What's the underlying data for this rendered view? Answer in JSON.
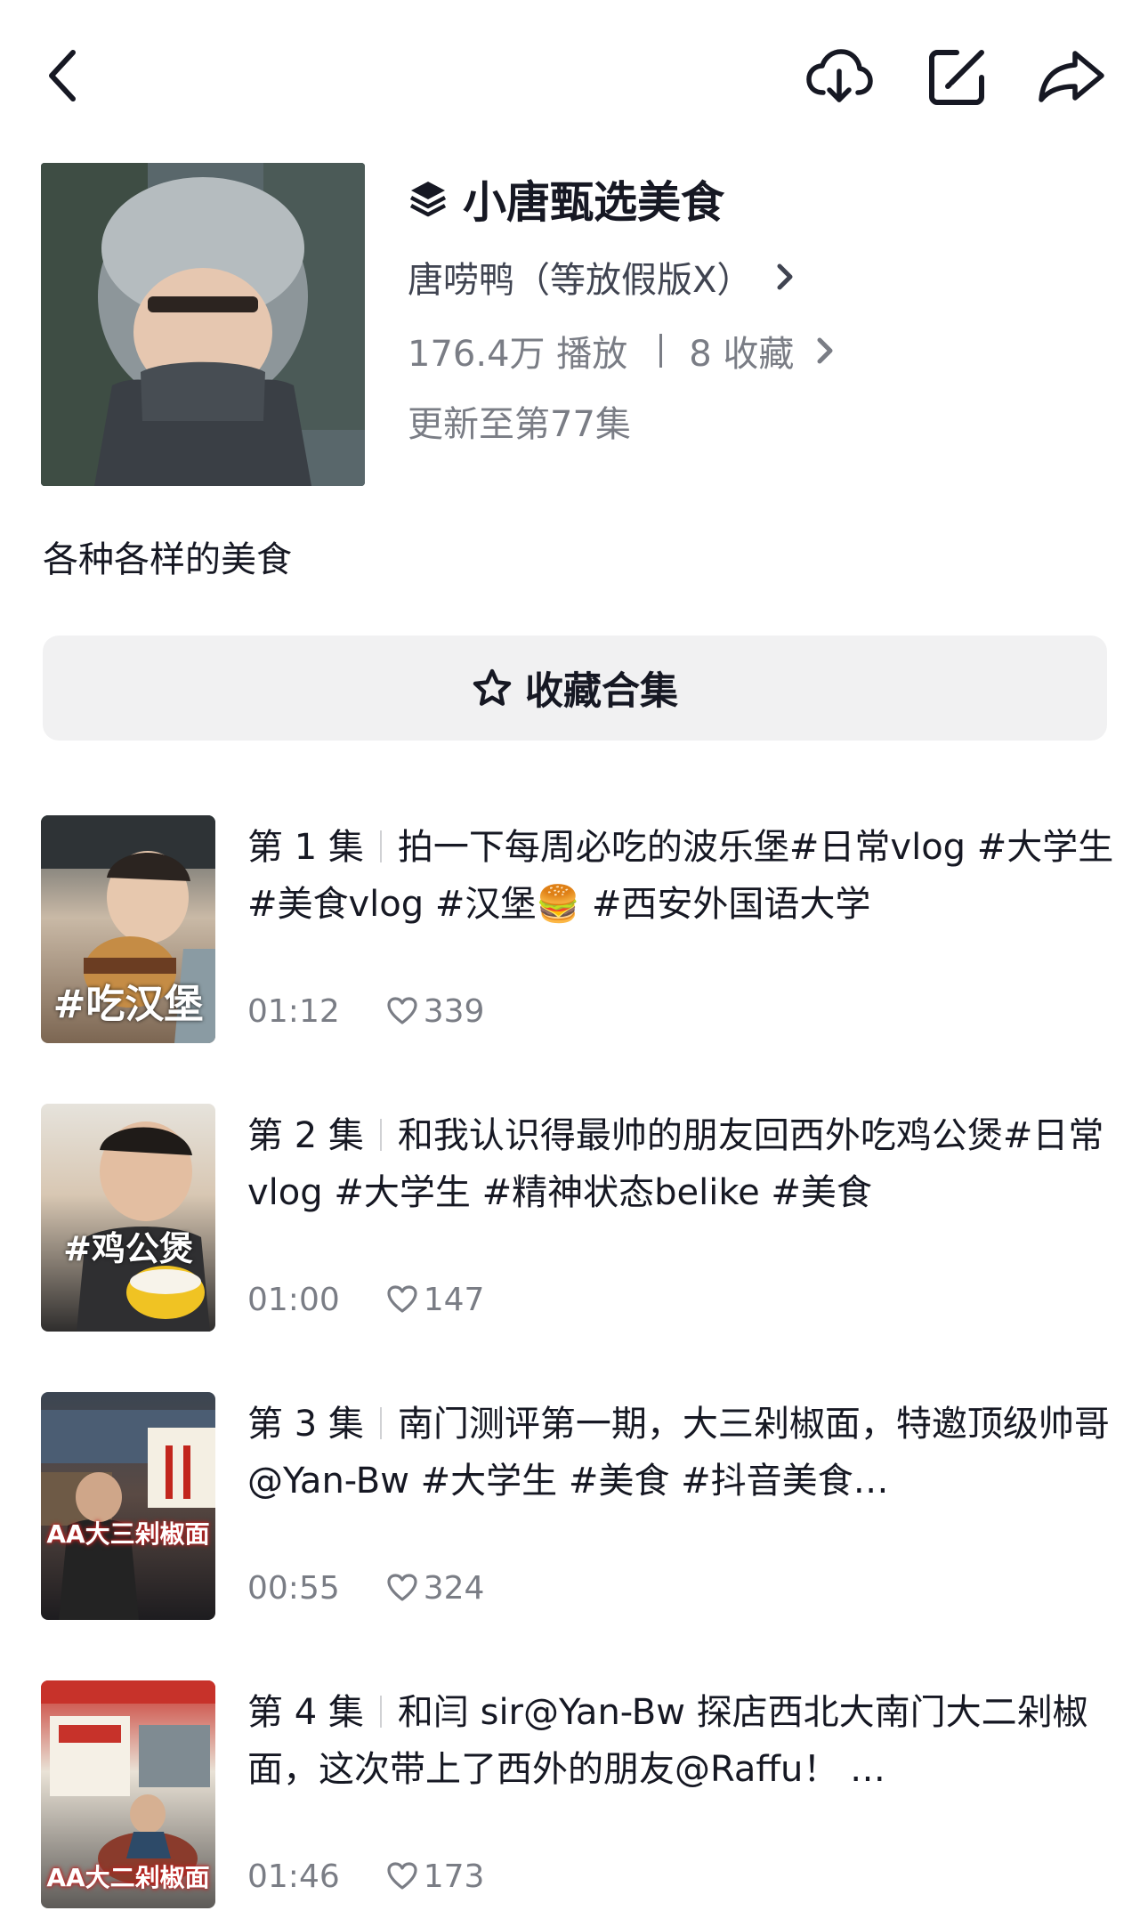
{
  "header": {
    "back_icon": "back-arrow-icon",
    "download_icon": "cloud-download-icon",
    "edit_icon": "edit-icon",
    "share_icon": "share-arrow-icon"
  },
  "collection": {
    "title_icon": "layers-icon",
    "title": "小唐甄选美食",
    "author": "唐唠鸭（等放假版X）",
    "plays": "176.4万 播放",
    "favorites": "8  收藏",
    "update_status": "更新至第77集",
    "description": "各种各样的美食"
  },
  "favorite_button": {
    "icon": "star-outline-icon",
    "label": "收藏合集"
  },
  "episodes": [
    {
      "number": "第 1 集",
      "title": "拍一下每周必吃的波乐堡#日常vlog #大学生 #美食vlog #汉堡🍔 #西安外国语大学",
      "duration": "01:12",
      "likes": "339",
      "thumb_tag": "#吃汉堡"
    },
    {
      "number": "第 2 集",
      "title": "和我认识得最帅的朋友回西外吃鸡公煲#日常vlog #大学生 #精神状态belike #美食",
      "duration": "01:00",
      "likes": "147",
      "thumb_tag": "#鸡公煲"
    },
    {
      "number": "第 3 集",
      "title": "南门测评第一期，大三剁椒面，特邀顶级帅哥@Yan-Bw #大学生 #美食 #抖音美食…",
      "duration": "00:55",
      "likes": "324",
      "thumb_tag": "AA大三剁椒面"
    },
    {
      "number": "第 4 集",
      "title": "和闫 sir@Yan-Bw 探店西北大南门大二剁椒面，这次带上了西外的朋友@Raffu！ …",
      "duration": "01:46",
      "likes": "173",
      "thumb_tag": "AA大二剁椒面"
    }
  ],
  "colors": {
    "primary_text": "#161823",
    "secondary_text": "#7a7d85",
    "button_bg": "#f1f1f2"
  }
}
